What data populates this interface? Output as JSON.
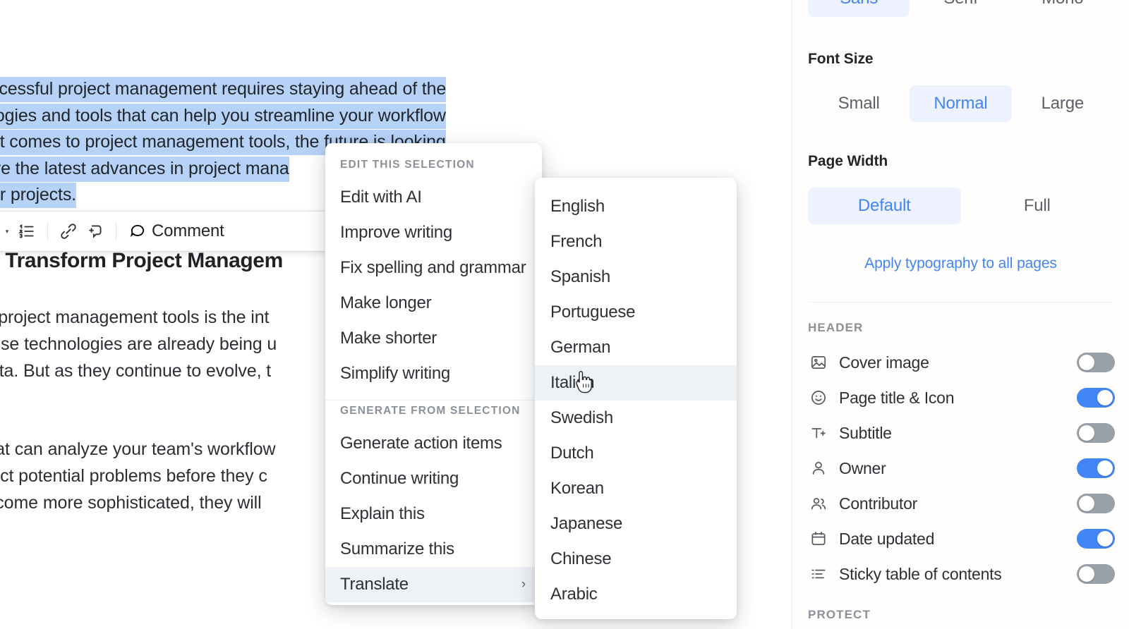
{
  "document": {
    "selected_paragraph_lines": [
      "successful project management requires staying ahead of the",
      "nologies and tools that can help you streamline your workflow",
      "en it comes to project management tools, the future is looking",
      "plore the latest advances in project mana",
      "your projects."
    ],
    "heading": "Will Transform Project Managem",
    "body_lines": [
      "ts in project management tools is the int",
      ". These technologies are already being u",
      "in data. But as they continue to evolve, t"
    ],
    "body_lines_2": [
      "m that can analyze your team's workflow",
      "predict potential problems before they c",
      "g become more sophisticated, they will"
    ]
  },
  "toolbar": {
    "align_icon": "align-left-icon",
    "align_caret_icon": "chevron-down-icon",
    "bullet_list_icon": "bullet-list-icon",
    "bullet_caret_icon": "chevron-down-icon",
    "checklist_icon": "numbered-list-icon",
    "link_icon": "link-icon",
    "footnote_icon": "add-comment-icon",
    "comment_icon": "comment-bubble-icon",
    "comment_label": "Comment"
  },
  "context_menu": {
    "section_1_title": "EDIT THIS SELECTION",
    "section_1_items": [
      {
        "label": "Edit with AI",
        "highlighted": false
      },
      {
        "label": "Improve writing",
        "highlighted": false
      },
      {
        "label": "Fix spelling and grammar",
        "highlighted": false
      },
      {
        "label": "Make longer",
        "highlighted": false
      },
      {
        "label": "Make shorter",
        "highlighted": false
      },
      {
        "label": "Simplify writing",
        "highlighted": false
      }
    ],
    "section_2_title": "GENERATE FROM SELECTION",
    "section_2_items": [
      {
        "label": "Generate action items",
        "highlighted": false,
        "submenu": false
      },
      {
        "label": "Continue writing",
        "highlighted": false,
        "submenu": false
      },
      {
        "label": "Explain this",
        "highlighted": false,
        "submenu": false
      },
      {
        "label": "Summarize this",
        "highlighted": false,
        "submenu": false
      },
      {
        "label": "Translate",
        "highlighted": true,
        "submenu": true,
        "chevron": "›"
      }
    ]
  },
  "translate_submenu": {
    "items": [
      {
        "label": "English",
        "highlighted": false
      },
      {
        "label": "French",
        "highlighted": false
      },
      {
        "label": "Spanish",
        "highlighted": false
      },
      {
        "label": "Portuguese",
        "highlighted": false
      },
      {
        "label": "German",
        "highlighted": false
      },
      {
        "label": "Italian",
        "highlighted": true
      },
      {
        "label": "Swedish",
        "highlighted": false
      },
      {
        "label": "Dutch",
        "highlighted": false
      },
      {
        "label": "Korean",
        "highlighted": false
      },
      {
        "label": "Japanese",
        "highlighted": false
      },
      {
        "label": "Chinese",
        "highlighted": false
      },
      {
        "label": "Arabic",
        "highlighted": false
      }
    ]
  },
  "panel": {
    "font_family": {
      "options": [
        "Sans",
        "Serif",
        "Mono"
      ],
      "selected": "Sans"
    },
    "font_size": {
      "label": "Font Size",
      "options": [
        "Small",
        "Normal",
        "Large"
      ],
      "selected": "Normal"
    },
    "page_width": {
      "label": "Page Width",
      "options": [
        "Default",
        "Full"
      ],
      "selected": "Default"
    },
    "apply_link": "Apply typography to all pages",
    "header_section": {
      "title": "HEADER",
      "rows": [
        {
          "label": "Cover image",
          "icon": "image-icon",
          "on": false
        },
        {
          "label": "Page title & Icon",
          "icon": "smiley-icon",
          "on": true
        },
        {
          "label": "Subtitle",
          "icon": "text-add-icon",
          "on": false
        },
        {
          "label": "Owner",
          "icon": "person-icon",
          "on": true
        },
        {
          "label": "Contributor",
          "icon": "people-icon",
          "on": false
        },
        {
          "label": "Date updated",
          "icon": "calendar-icon",
          "on": true
        },
        {
          "label": "Sticky table of contents",
          "icon": "list-icon",
          "on": false
        }
      ]
    },
    "protect_section": {
      "title": "PROTECT"
    }
  },
  "colors": {
    "accent": "#4285f4",
    "accent_bg": "#edf2fe",
    "selection": "#b6d2f6",
    "hover": "#eef1f5",
    "toggle_off": "#9aa0a8"
  }
}
